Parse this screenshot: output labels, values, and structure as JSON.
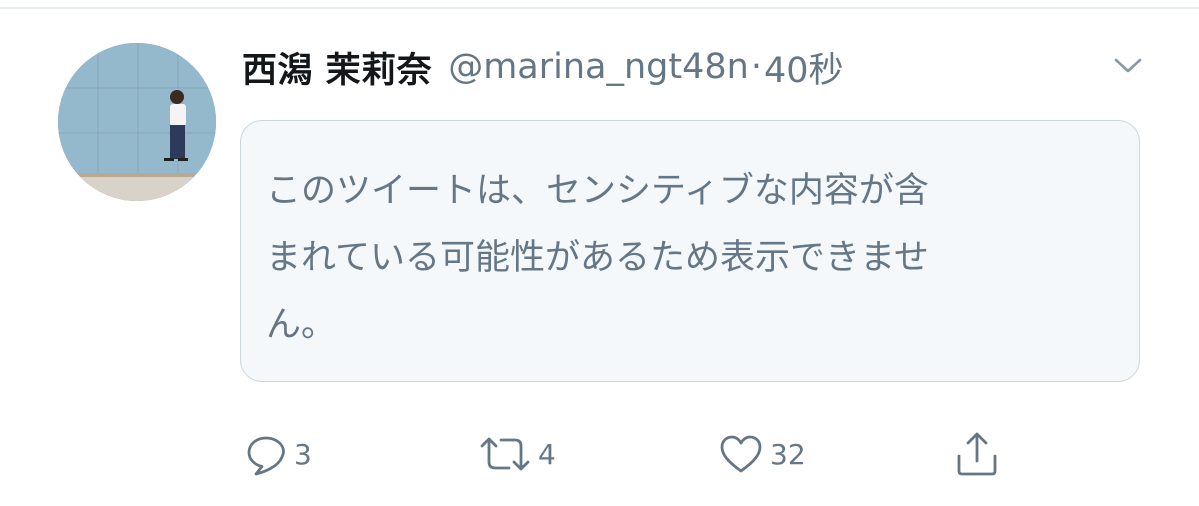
{
  "tweet": {
    "display_name": "西潟 茉莉奈",
    "handle": "@marina_ngt48n",
    "separator": "·",
    "time": "40秒",
    "notice_line1": "このツイートは、センシティブな内容が含",
    "notice_line2": "まれている可能性があるため表示できませ",
    "notice_line3": "ん。"
  },
  "actions": {
    "reply_count": "3",
    "retweet_count": "4",
    "like_count": "32"
  },
  "icons": {
    "menu": "chevron-down-icon",
    "reply": "reply-bubble-icon",
    "retweet": "retweet-icon",
    "like": "heart-icon",
    "share": "share-icon"
  },
  "colors": {
    "text_primary": "#14171a",
    "text_secondary": "#657786",
    "card_background": "#f5f8fa",
    "card_border": "#ccd6dd"
  }
}
